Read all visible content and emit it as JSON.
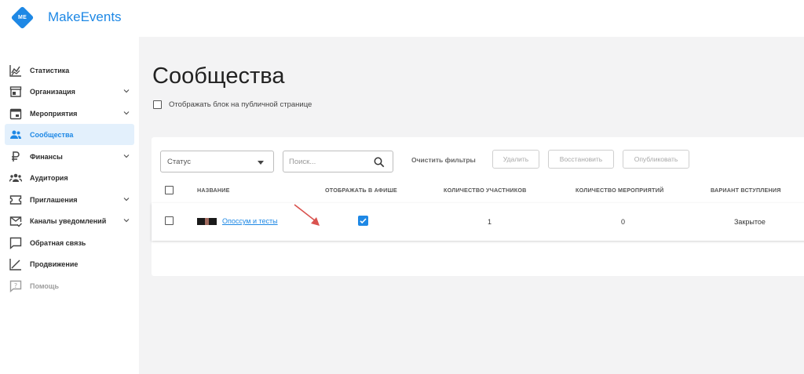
{
  "app": {
    "logo_text": "ME",
    "brand": "MakeEvents"
  },
  "sidebar": {
    "items": [
      {
        "label": "Статистика",
        "icon": "stats-chart-icon",
        "expandable": false
      },
      {
        "label": "Организация",
        "icon": "store-icon",
        "expandable": true
      },
      {
        "label": "Мероприятия",
        "icon": "calendar-icon",
        "expandable": true
      },
      {
        "label": "Сообщества",
        "icon": "people-icon",
        "expandable": false,
        "active": true
      },
      {
        "label": "Финансы",
        "icon": "ruble-icon",
        "expandable": true
      },
      {
        "label": "Аудитория",
        "icon": "group-icon",
        "expandable": false
      },
      {
        "label": "Приглашения",
        "icon": "ticket-icon",
        "expandable": true
      },
      {
        "label": "Каналы уведомлений",
        "icon": "mail-check-icon",
        "expandable": true
      },
      {
        "label": "Обратная связь",
        "icon": "feedback-icon",
        "expandable": false
      },
      {
        "label": "Продвижение",
        "icon": "trend-icon",
        "expandable": false
      },
      {
        "label": "Помощь",
        "icon": "help-icon",
        "expandable": false,
        "muted": true
      }
    ]
  },
  "page": {
    "title": "Сообщества",
    "public_block_label": "Отображать блок на публичной странице",
    "public_block_checked": false
  },
  "filters": {
    "status_placeholder": "Статус",
    "search_placeholder": "Поиск...",
    "clear_label": "Очистить фильтры",
    "delete_label": "Удалить",
    "restore_label": "Восстановить",
    "publish_label": "Опубликовать"
  },
  "table": {
    "columns": [
      "НАЗВАНИЕ",
      "ОТОБРАЖАТЬ В АФИШЕ",
      "КОЛИЧЕСТВО УЧАСТНИКОВ",
      "КОЛИЧЕСТВО МЕРОПРИЯТИЙ",
      "ВАРИАНТ ВСТУПЛЕНИЯ"
    ],
    "rows": [
      {
        "name": "Опоссум и тесты",
        "show_in_poster": true,
        "participants": "1",
        "events": "0",
        "join_type": "Закрытое"
      }
    ]
  },
  "colors": {
    "accent": "#1e88e5",
    "annotation_arrow": "#d9534f"
  }
}
